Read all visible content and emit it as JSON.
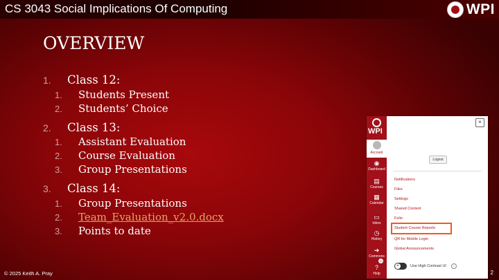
{
  "header": {
    "course_title": "CS 3043 Social Implications Of Computing",
    "logo_text": "WPI"
  },
  "slide": {
    "title": "OVERVIEW",
    "outline": [
      {
        "num": "1.",
        "label": "Class 12:",
        "items": [
          {
            "num": "1.",
            "label": "Students Present"
          },
          {
            "num": "2.",
            "label": "Students’ Choice"
          }
        ]
      },
      {
        "num": "2.",
        "label": "Class 13:",
        "items": [
          {
            "num": "1.",
            "label": "Assistant Evaluation"
          },
          {
            "num": "2.",
            "label": "Course Evaluation"
          },
          {
            "num": "3.",
            "label": "Group Presentations"
          }
        ]
      },
      {
        "num": "3.",
        "label": "Class 14:",
        "items": [
          {
            "num": "1.",
            "label": "Group Presentations"
          },
          {
            "num": "2.",
            "label": "Team_Evaluation_v2.0.docx"
          },
          {
            "num": "3.",
            "label": "Points to date"
          }
        ]
      }
    ]
  },
  "footer": {
    "copyright": "© 2025 Keith A. Pray",
    "page_number": "2"
  },
  "canvas": {
    "logo_text": "WPI",
    "nav": {
      "account": "Account",
      "dashboard": "Dashboard",
      "courses": "Courses",
      "calendar": "Calendar",
      "inbox": "Inbox",
      "history": "History",
      "commons": "Commons",
      "help": "Help",
      "help_badge": "10"
    },
    "close": "×",
    "logout": "Logout",
    "menu": [
      "Notifications",
      "Files",
      "Settings",
      "Shared Content",
      "Folio",
      "Student Course Reports",
      "QR for Mobile Login",
      "Global Announcements"
    ],
    "contrast_label": "Use High Contrast UI",
    "toggle_icon": "×",
    "info": "i"
  },
  "colors": {
    "slide_bg": "#8a0508",
    "link": "#e3a567",
    "canvas_nav": "#a2101a",
    "highlight": "#f05a1a"
  }
}
